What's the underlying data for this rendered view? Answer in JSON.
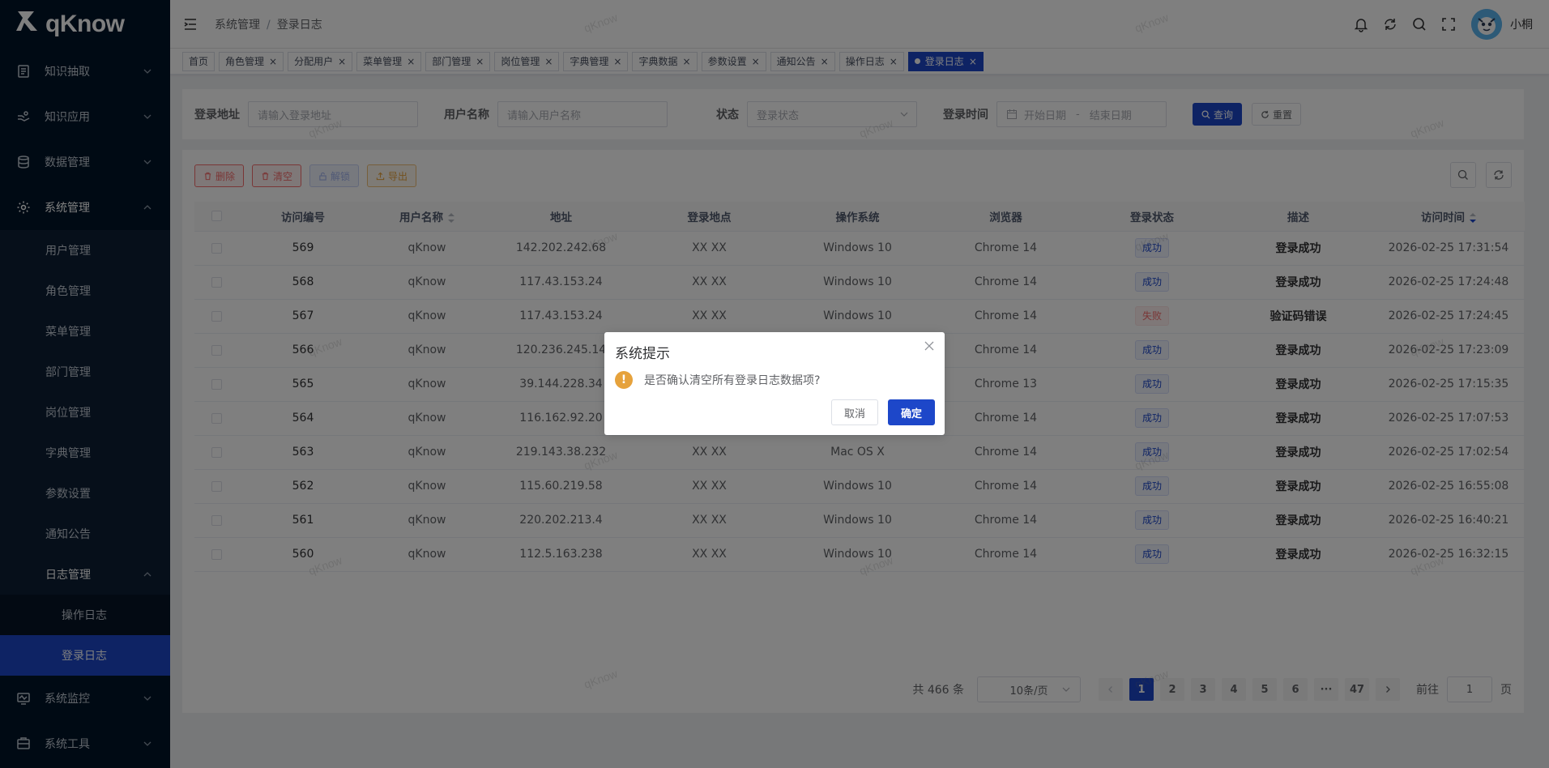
{
  "brand": {
    "name": "qKnow"
  },
  "sidebar": {
    "top_items": [
      {
        "label": "知识抽取"
      },
      {
        "label": "知识应用"
      },
      {
        "label": "数据管理"
      }
    ],
    "system": {
      "label": "系统管理",
      "subs": [
        {
          "label": "用户管理"
        },
        {
          "label": "角色管理"
        },
        {
          "label": "菜单管理"
        },
        {
          "label": "部门管理"
        },
        {
          "label": "岗位管理"
        },
        {
          "label": "字典管理"
        },
        {
          "label": "参数设置"
        },
        {
          "label": "通知公告"
        }
      ],
      "log_group": {
        "label": "日志管理",
        "subs": [
          {
            "label": "操作日志"
          },
          {
            "label": "登录日志"
          }
        ]
      }
    },
    "bottom_items": [
      {
        "label": "系统监控"
      },
      {
        "label": "系统工具"
      }
    ]
  },
  "header": {
    "breadcrumb": [
      "系统管理",
      "登录日志"
    ],
    "breadcrumb_sep": "/",
    "user_name": "小桐"
  },
  "tags": [
    {
      "label": "首页",
      "closable": false
    },
    {
      "label": "角色管理"
    },
    {
      "label": "分配用户"
    },
    {
      "label": "菜单管理"
    },
    {
      "label": "部门管理"
    },
    {
      "label": "岗位管理"
    },
    {
      "label": "字典管理"
    },
    {
      "label": "字典数据"
    },
    {
      "label": "参数设置"
    },
    {
      "label": "通知公告"
    },
    {
      "label": "操作日志"
    },
    {
      "label": "登录日志",
      "active": true
    }
  ],
  "tag_close": "×",
  "search": {
    "ipaddr_label": "登录地址",
    "ipaddr_placeholder": "请输入登录地址",
    "user_label": "用户名称",
    "user_placeholder": "请输入用户名称",
    "status_label": "状态",
    "status_placeholder": "登录状态",
    "time_label": "登录时间",
    "start_placeholder": "开始日期",
    "range_sep": "-",
    "end_placeholder": "结束日期",
    "query_btn": "查询",
    "reset_btn": "重置"
  },
  "toolbar": {
    "delete_btn": "删除",
    "clean_btn": "清空",
    "unlock_btn": "解锁",
    "export_btn": "导出"
  },
  "table": {
    "columns": [
      "访问编号",
      "用户名称",
      "地址",
      "登录地点",
      "操作系统",
      "浏览器",
      "登录状态",
      "描述",
      "访问时间"
    ],
    "rows": [
      {
        "id": "569",
        "user": "qKnow",
        "ip": "142.202.242.68",
        "loc": "XX XX",
        "os": "Windows 10",
        "browser": "Chrome 14",
        "status": "成功",
        "ok": true,
        "msg": "登录成功",
        "time": "2026-02-25 17:31:54"
      },
      {
        "id": "568",
        "user": "qKnow",
        "ip": "117.43.153.24",
        "loc": "XX XX",
        "os": "Windows 10",
        "browser": "Chrome 14",
        "status": "成功",
        "ok": true,
        "msg": "登录成功",
        "time": "2026-02-25 17:24:48"
      },
      {
        "id": "567",
        "user": "qKnow",
        "ip": "117.43.153.24",
        "loc": "XX XX",
        "os": "Windows 10",
        "browser": "Chrome 14",
        "status": "失败",
        "ok": false,
        "msg": "验证码错误",
        "time": "2026-02-25 17:24:45"
      },
      {
        "id": "566",
        "user": "qKnow",
        "ip": "120.236.245.14",
        "loc": "",
        "os": "",
        "browser": "Chrome 14",
        "status": "成功",
        "ok": true,
        "msg": "登录成功",
        "time": "2026-02-25 17:23:09"
      },
      {
        "id": "565",
        "user": "qKnow",
        "ip": "39.144.228.34",
        "loc": "",
        "os": "",
        "browser": "Chrome 13",
        "status": "成功",
        "ok": true,
        "msg": "登录成功",
        "time": "2026-02-25 17:15:35"
      },
      {
        "id": "564",
        "user": "qKnow",
        "ip": "116.162.92.20",
        "loc": "",
        "os": "",
        "browser": "Chrome 14",
        "status": "成功",
        "ok": true,
        "msg": "登录成功",
        "time": "2026-02-25 17:07:53"
      },
      {
        "id": "563",
        "user": "qKnow",
        "ip": "219.143.38.232",
        "loc": "XX XX",
        "os": "Mac OS X",
        "browser": "Chrome 14",
        "status": "成功",
        "ok": true,
        "msg": "登录成功",
        "time": "2026-02-25 17:02:54"
      },
      {
        "id": "562",
        "user": "qKnow",
        "ip": "115.60.219.58",
        "loc": "XX XX",
        "os": "Windows 10",
        "browser": "Chrome 14",
        "status": "成功",
        "ok": true,
        "msg": "登录成功",
        "time": "2026-02-25 16:55:08"
      },
      {
        "id": "561",
        "user": "qKnow",
        "ip": "220.202.213.4",
        "loc": "XX XX",
        "os": "Windows 10",
        "browser": "Chrome 14",
        "status": "成功",
        "ok": true,
        "msg": "登录成功",
        "time": "2026-02-25 16:40:21"
      },
      {
        "id": "560",
        "user": "qKnow",
        "ip": "112.5.163.238",
        "loc": "XX XX",
        "os": "Windows 10",
        "browser": "Chrome 14",
        "status": "成功",
        "ok": true,
        "msg": "登录成功",
        "time": "2026-02-25 16:32:15"
      }
    ]
  },
  "pagination": {
    "total_text": "共 466 条",
    "page_size": "10条/页",
    "pages": [
      "1",
      "2",
      "3",
      "4",
      "5",
      "6",
      "···",
      "47"
    ],
    "current": "1",
    "goto_label": "前往",
    "goto_value": "1",
    "goto_suffix": "页"
  },
  "dialog": {
    "title": "系统提示",
    "message": "是否确认清空所有登录日志数据项?",
    "icon_glyph": "!",
    "cancel_btn": "取消",
    "confirm_btn": "确定"
  },
  "watermark": "qKnow",
  "colors": {
    "primary": "#1d47c9",
    "sidebar_bg": "#001529",
    "danger": "#f56c6c",
    "warning": "#e6a23c"
  }
}
